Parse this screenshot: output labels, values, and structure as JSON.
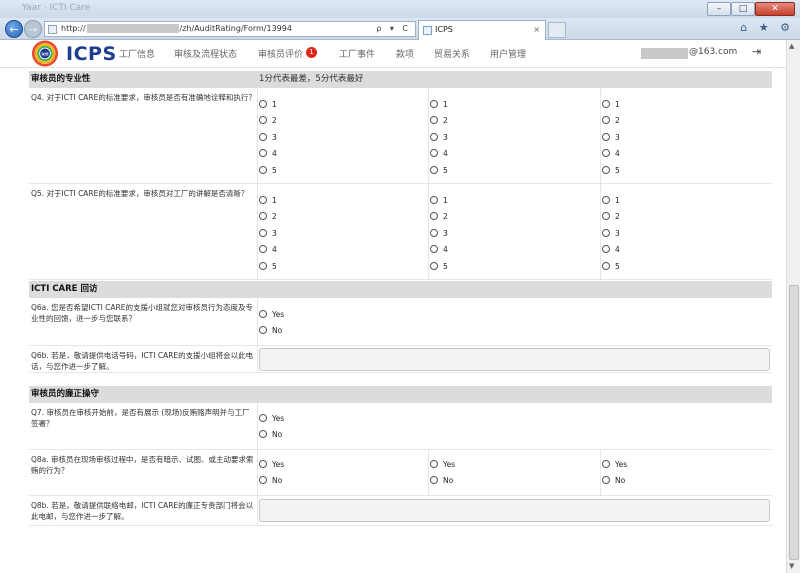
{
  "browser": {
    "title_faded": "Yaar · ICTI Care",
    "address_prefix": "http://",
    "address_suffix": "/zh/AuditRating/Form/13994",
    "address_tools": "ρ ▾ C",
    "tab_title": "ICPS",
    "tab_close": "×",
    "btn_min": "–",
    "btn_max": "□",
    "btn_close": "✕",
    "back": "←",
    "forward": "→",
    "ie_icons": "⌂ ★ ⚙"
  },
  "header": {
    "brand": "ICPS",
    "nav": [
      {
        "label": "工厂信息"
      },
      {
        "label": "审核及流程状态"
      },
      {
        "label": "审核员评价",
        "badge": "1"
      },
      {
        "label": "工厂事件"
      },
      {
        "label": "款项"
      },
      {
        "label": "贸易关系"
      },
      {
        "label": "用户管理"
      }
    ],
    "user_domain": "@163.com",
    "logout_icon": "⇥"
  },
  "sections": [
    {
      "title": "审核员的专业性",
      "note": "1分代表最差，5分代表最好"
    },
    {
      "title": "ICTI CARE 回访",
      "note": ""
    },
    {
      "title": "审核员的廉正操守",
      "note": ""
    }
  ],
  "questions": {
    "q4": "Q4. 对于ICTI CARE的标准要求，审核员是否有准确地诠释和执行？",
    "q5": "Q5. 对于ICTI CARE的标准要求，审核员对工厂的讲解是否清晰？",
    "q6a": "Q6a. 您是否希望ICTI CARE的支援小组就您对审核员行为态度及专业性的回馈，进一步与您联系？",
    "q6b": "Q6b. 若是，敬请提供电话号码，ICTI CARE的支援小组将会以此电话，与您作进一步了解。",
    "q7": "Q7. 审核员在审核开始前，是否有展示 (现场)反贿赂声明并与工厂签署？",
    "q8a": "Q8a. 审核员在现场审核过程中，是否有暗示、试图、或主动要求索贿的行为？",
    "q8b": "Q8b. 若是，敬请提供联络电邮，ICTI CARE的廉正专责部门将会以此电邮，与您作进一步了解。"
  },
  "options": {
    "scale": [
      "1",
      "2",
      "3",
      "4",
      "5"
    ],
    "yes": "Yes",
    "no": "No"
  }
}
